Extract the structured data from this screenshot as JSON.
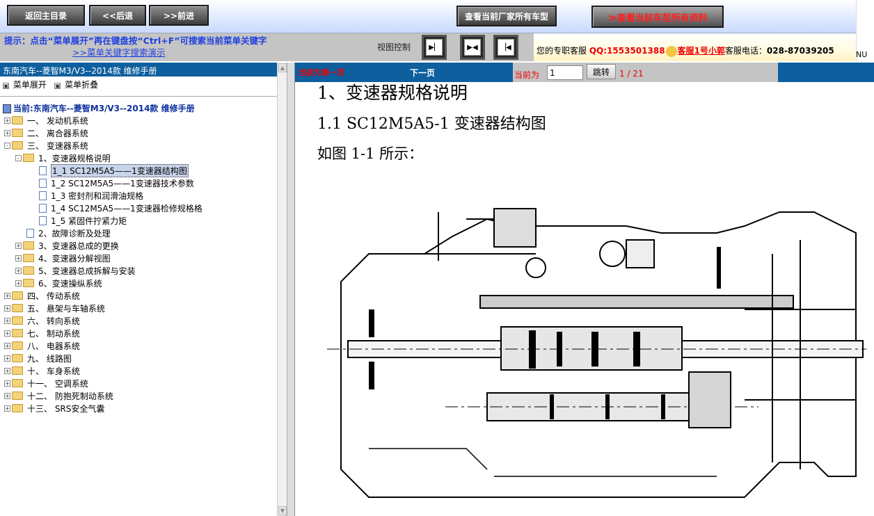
{
  "toolbar": {
    "back_main": "返回主目录",
    "prev": "<<后退",
    "next": ">>前进",
    "all_models": "查看当前厂家所有车型",
    "model_docs": "≫查看当前车型所有资料"
  },
  "hint": {
    "text": "提示：点击“菜单展开”再在键盘按“Ctrl+F”可搜索当前菜单关键字",
    "link": ">>菜单关键字搜索演示"
  },
  "view_control": {
    "label": "视图控制"
  },
  "contact": {
    "prefix": "您的专职客服",
    "qq": "QQ:1553501388",
    "service": "客服1号小郭",
    "phone_label": "客服电话：",
    "phone": "028-87039205",
    "corner": "NU"
  },
  "tree": {
    "title": "东南汽车--菱智M3/V3--2014款 维修手册",
    "expand": "菜单展开",
    "collapse": "菜单折叠",
    "current": "当前:东南汽车--菱智M3/V3--2014款 维修手册",
    "items": [
      {
        "label": "一、 发动机系统"
      },
      {
        "label": "二、 离合器系统"
      },
      {
        "label": "三、 变速器系统"
      },
      {
        "label": "1、变速器规格说明"
      },
      {
        "label": "1_1 SC12M5A5——1变速器结构图"
      },
      {
        "label": "1_2 SC12M5A5——1变速器技术参数"
      },
      {
        "label": "1_3 密封剂和润滑油规格"
      },
      {
        "label": "1_4 SC12M5A5——1变速器检修规格格"
      },
      {
        "label": "1_5 紧固件拧紧力矩"
      },
      {
        "label": "2、故障诊断及处理"
      },
      {
        "label": "3、变速器总成的更换"
      },
      {
        "label": "4、变速器分解视图"
      },
      {
        "label": "5、变速器总成拆解与安装"
      },
      {
        "label": "6、变速操纵系统"
      },
      {
        "label": "四、 传动系统"
      },
      {
        "label": "五、 悬架与车轴系统"
      },
      {
        "label": "六、 转向系统"
      },
      {
        "label": "七、 制动系统"
      },
      {
        "label": "八、 电器系统"
      },
      {
        "label": "九、 线路图"
      },
      {
        "label": "十、 车身系统"
      },
      {
        "label": "十一、 空调系统"
      },
      {
        "label": "十二、 防抱死制动系统"
      },
      {
        "label": "十三、 SRS安全气囊"
      }
    ]
  },
  "pager": {
    "current_first": "当前为第一页",
    "next": "下一页",
    "current_label": "当前为",
    "page_value": "1",
    "jump": "跳转",
    "page_count": "1 / 21"
  },
  "doc": {
    "h1": "1、变速器规格说明",
    "h2": "1.1 SC12M5A5-1 变速器结构图",
    "figure_ref": "如图 1-1 所示："
  }
}
